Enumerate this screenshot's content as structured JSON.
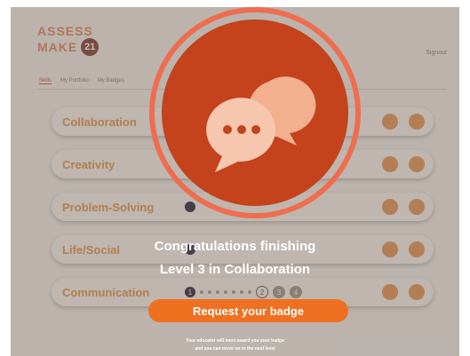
{
  "brand": {
    "line1": "ASSESS",
    "line2": "MAKE",
    "number": "21"
  },
  "header": {
    "sign_out": "Signout"
  },
  "tabs": [
    {
      "label": "Skills"
    },
    {
      "label": "My Portfolio"
    },
    {
      "label": "My Badges"
    }
  ],
  "skills": [
    {
      "name": "Collaboration"
    },
    {
      "name": "Creativity"
    },
    {
      "name": "Problem-Solving"
    },
    {
      "name": "Life/Social"
    },
    {
      "name": "Communication"
    }
  ],
  "levels": {
    "first": "1",
    "second": "2",
    "third": "3",
    "fourth": "4"
  },
  "modal": {
    "icon": "chat-bubbles-icon",
    "line1": "Congratulations finishing",
    "line2": "Level 3 in Collaboration",
    "button": "Request your badge",
    "note1": "Your educator will soon award you your badge",
    "note2": "and you can move on to the next level"
  },
  "colors": {
    "accent": "#ef7020",
    "circle": "#c4431c",
    "ring": "#ee6d4e"
  }
}
